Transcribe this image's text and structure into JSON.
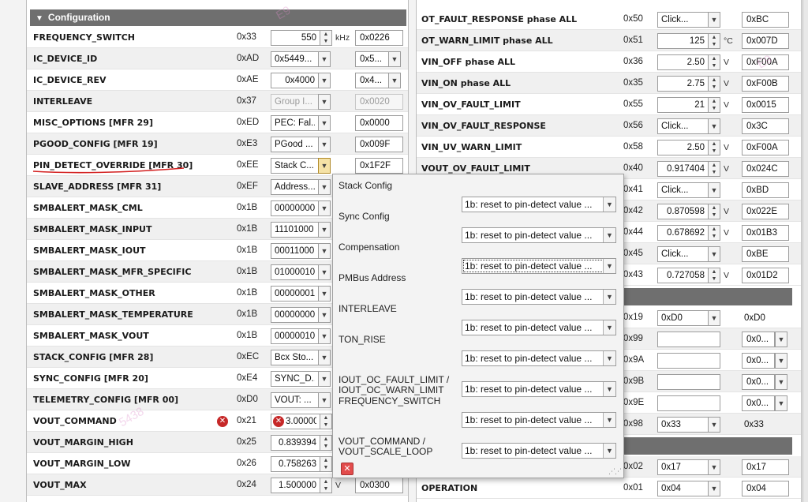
{
  "left": {
    "section_title": "Configuration",
    "rows": [
      {
        "name": "FREQUENCY_SWITCH",
        "addr": "0x33",
        "ctrl": "spin",
        "value": "550",
        "unit": "kHz",
        "hex": "0x0226"
      },
      {
        "name": "IC_DEVICE_ID",
        "addr": "0xAD",
        "ctrl": "dd",
        "value": "0x5449...",
        "hex": "0x5...",
        "hex_dd": true
      },
      {
        "name": "IC_DEVICE_REV",
        "addr": "0xAE",
        "ctrl": "dd",
        "value": "0x4000",
        "value_right": true,
        "hex": "0x4...",
        "hex_dd": true
      },
      {
        "name": "INTERLEAVE",
        "addr": "0x37",
        "ctrl": "dd",
        "value": "Group I...",
        "disabled": true,
        "hex": "0x0020",
        "hex_disabled": true
      },
      {
        "name": "MISC_OPTIONS [MFR 29]",
        "addr": "0xED",
        "ctrl": "dd",
        "value": "PEC: Fal...",
        "hex": "0x0000"
      },
      {
        "name": "PGOOD_CONFIG [MFR 19]",
        "addr": "0xE3",
        "ctrl": "dd",
        "value": "PGood ...",
        "hex": "0x009F"
      },
      {
        "name": "PIN_DETECT_OVERRIDE [MFR 30]",
        "addr": "0xEE",
        "ctrl": "dd",
        "value": "Stack C...",
        "active": true,
        "hex": "0x1F2F"
      },
      {
        "name": "SLAVE_ADDRESS [MFR 31]",
        "addr": "0xEF",
        "ctrl": "dd",
        "value": "Address..."
      },
      {
        "name": "SMBALERT_MASK_CML",
        "addr": "0x1B",
        "ctrl": "dd",
        "value": "00000000"
      },
      {
        "name": "SMBALERT_MASK_INPUT",
        "addr": "0x1B",
        "ctrl": "dd",
        "value": "11101000"
      },
      {
        "name": "SMBALERT_MASK_IOUT",
        "addr": "0x1B",
        "ctrl": "dd",
        "value": "00011000"
      },
      {
        "name": "SMBALERT_MASK_MFR_SPECIFIC",
        "addr": "0x1B",
        "ctrl": "dd",
        "value": "01000010"
      },
      {
        "name": "SMBALERT_MASK_OTHER",
        "addr": "0x1B",
        "ctrl": "dd",
        "value": "00000001"
      },
      {
        "name": "SMBALERT_MASK_TEMPERATURE",
        "addr": "0x1B",
        "ctrl": "dd",
        "value": "00000000"
      },
      {
        "name": "SMBALERT_MASK_VOUT",
        "addr": "0x1B",
        "ctrl": "dd",
        "value": "00000010"
      },
      {
        "name": "STACK_CONFIG [MFR 28]",
        "addr": "0xEC",
        "ctrl": "dd",
        "value": "Bcx Sto..."
      },
      {
        "name": "SYNC_CONFIG [MFR 20]",
        "addr": "0xE4",
        "ctrl": "dd",
        "value": "SYNC_D..."
      },
      {
        "name": "TELEMETRY_CONFIG [MFR 00]",
        "addr": "0xD0",
        "ctrl": "dd",
        "value": "VOUT: ..."
      },
      {
        "name": "VOUT_COMMAND",
        "addr": "0x21",
        "ctrl": "spin",
        "value": "3.000000",
        "error": true
      },
      {
        "name": "VOUT_MARGIN_HIGH",
        "addr": "0x25",
        "ctrl": "spin",
        "value": "0.839394"
      },
      {
        "name": "VOUT_MARGIN_LOW",
        "addr": "0x26",
        "ctrl": "spin",
        "value": "0.758263"
      },
      {
        "name": "VOUT_MAX",
        "addr": "0x24",
        "ctrl": "spin",
        "value": "1.500000",
        "unit": "V",
        "hex": "0x0300"
      }
    ]
  },
  "right": {
    "rows": [
      {
        "name": "OT_FAULT_RESPONSE  phase ALL",
        "addr": "0x50",
        "ctrl": "dd",
        "value": "Click...",
        "hex": "0xBC"
      },
      {
        "name": "OT_WARN_LIMIT  phase ALL",
        "addr": "0x51",
        "ctrl": "spin",
        "value": "125",
        "unit": "°C",
        "hex": "0x007D"
      },
      {
        "name": "VIN_OFF  phase ALL",
        "addr": "0x36",
        "ctrl": "spin",
        "value": "2.50",
        "unit": "V",
        "hex": "0xF00A"
      },
      {
        "name": "VIN_ON  phase ALL",
        "addr": "0x35",
        "ctrl": "spin",
        "value": "2.75",
        "unit": "V",
        "hex": "0xF00B"
      },
      {
        "name": "VIN_OV_FAULT_LIMIT",
        "addr": "0x55",
        "ctrl": "spin",
        "value": "21",
        "unit": "V",
        "hex": "0x0015"
      },
      {
        "name": "VIN_OV_FAULT_RESPONSE",
        "addr": "0x56",
        "ctrl": "dd",
        "value": "Click...",
        "hex": "0x3C"
      },
      {
        "name": "VIN_UV_WARN_LIMIT",
        "addr": "0x58",
        "ctrl": "spin",
        "value": "2.50",
        "unit": "V",
        "hex": "0xF00A"
      },
      {
        "name": "VOUT_OV_FAULT_LIMIT",
        "addr": "0x40",
        "ctrl": "spin",
        "value": "0.917404",
        "unit": "V",
        "hex": "0x024C"
      },
      {
        "name": "",
        "addr": "0x41",
        "ctrl": "dd",
        "value": "Click...",
        "hex": "0xBD"
      },
      {
        "name": "",
        "addr": "0x42",
        "ctrl": "spin",
        "value": "0.870598",
        "unit": "V",
        "hex": "0x022E"
      },
      {
        "name": "",
        "addr": "0x44",
        "ctrl": "spin",
        "value": "0.678692",
        "unit": "V",
        "hex": "0x01B3"
      },
      {
        "name": "",
        "addr": "0x45",
        "ctrl": "dd",
        "value": "Click...",
        "hex": "0xBE"
      },
      {
        "name": "",
        "addr": "0x43",
        "ctrl": "spin",
        "value": "0.727058",
        "unit": "V",
        "hex": "0x01D2"
      },
      {
        "section": true
      },
      {
        "name": "",
        "addr": "0x19",
        "ctrl": "dd",
        "value": "0xD0",
        "hex": "0xD0",
        "hex_plain": true
      },
      {
        "name": "",
        "addr": "0x99",
        "ctrl": "empty",
        "hex": "0x0...",
        "hex_dd": true
      },
      {
        "name": "",
        "addr": "0x9A",
        "ctrl": "empty",
        "hex": "0x0...",
        "hex_dd": true
      },
      {
        "name": "",
        "addr": "0x9B",
        "ctrl": "empty",
        "hex": "0x0...",
        "hex_dd": true
      },
      {
        "name": "",
        "addr": "0x9E",
        "ctrl": "empty",
        "hex": "0x0...",
        "hex_dd": true
      },
      {
        "name": "",
        "addr": "0x98",
        "ctrl": "dd",
        "value": "0x33",
        "hex": "0x33",
        "hex_plain": true
      },
      {
        "section": true
      },
      {
        "name": "",
        "addr": "0x02",
        "ctrl": "dd",
        "value": "0x17",
        "hex": "0x17"
      },
      {
        "name": "OPERATION",
        "addr": "0x01",
        "ctrl": "dd",
        "value": "0x04",
        "hex": "0x04"
      }
    ]
  },
  "popup": {
    "items": [
      {
        "label": "Stack Config",
        "value": "1b: reset to pin-detect value ..."
      },
      {
        "label": "Sync Config",
        "value": "1b: reset to pin-detect value ..."
      },
      {
        "label": "Compensation",
        "value": "1b: reset to pin-detect value ...",
        "focused": true
      },
      {
        "label": "PMBus Address",
        "value": "1b: reset to pin-detect value ..."
      },
      {
        "label": "INTERLEAVE",
        "value": "1b: reset to pin-detect value ..."
      },
      {
        "label": "TON_RISE",
        "value": "1b: reset to pin-detect value ..."
      },
      {
        "label": "IOUT_OC_FAULT_LIMIT / IOUT_OC_WARN_LIMIT",
        "value": "1b: reset to pin-detect value ..."
      },
      {
        "label": "FREQUENCY_SWITCH",
        "value": "1b: reset to pin-detect value ..."
      },
      {
        "label": "VOUT_COMMAND / VOUT_SCALE_LOOP",
        "value": "1b: reset to pin-detect value ..."
      }
    ],
    "close_icon": "close-x-icon"
  },
  "colors": {
    "header": "#6f6f6f",
    "error": "#c62828",
    "annotation": "#d32020"
  }
}
